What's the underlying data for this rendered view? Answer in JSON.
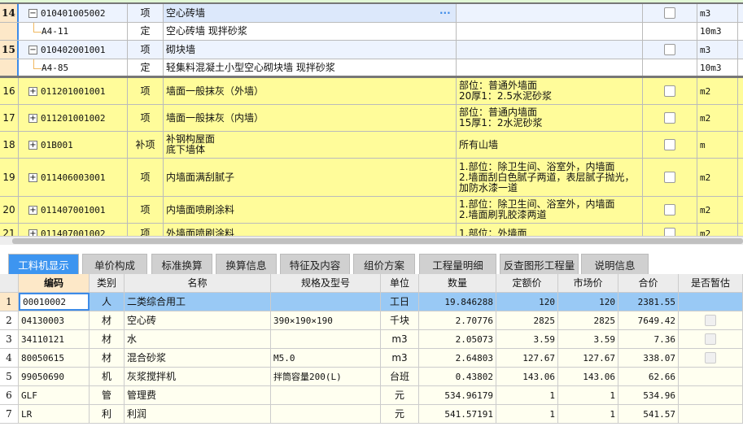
{
  "top_grid": {
    "rows": [
      {
        "num": "14",
        "code": "010401005002",
        "type": "项",
        "name": "空心砖墙",
        "feature": "",
        "unit": "m3",
        "kind": "item-open",
        "has_ellipsis": true
      },
      {
        "num": "",
        "code": "A4-11",
        "type": "定",
        "name": "空心砖墙 现拌砂浆",
        "feature": "",
        "unit": "10m3",
        "kind": "sub"
      },
      {
        "num": "15",
        "code": "010402001001",
        "type": "项",
        "name": "砌块墙",
        "feature": "",
        "unit": "m3",
        "kind": "item-open"
      },
      {
        "num": "",
        "code": "A4-85",
        "type": "定",
        "name": "轻集料混凝土小型空心砌块墙 现拌砂浆",
        "feature": "",
        "unit": "10m3",
        "kind": "sub"
      },
      {
        "num": "16",
        "code": "011201001001",
        "type": "项",
        "name": "墙面一般抹灰（外墙）",
        "feature": "部位：普通外墙面\n20厚1：2.5水泥砂浆",
        "unit": "m2",
        "kind": "item"
      },
      {
        "num": "17",
        "code": "011201001002",
        "type": "项",
        "name": "墙面一般抹灰（内墙）",
        "feature": "部位：普通内墙面\n15厚1：2水泥砂浆",
        "unit": "m2",
        "kind": "item"
      },
      {
        "num": "18",
        "code": "01B001",
        "type": "补项",
        "name": "补钢构屋面\n底下墙体",
        "feature": "所有山墙",
        "unit": "m",
        "kind": "item"
      },
      {
        "num": "19",
        "code": "011406003001",
        "type": "项",
        "name": "内墙面满刮腻子",
        "feature": "1.部位：除卫生间、浴室外，内墙面\n2.墙面刮白色腻子两道，表层腻子抛光，\n加防水漆一道",
        "unit": "m2",
        "kind": "item"
      },
      {
        "num": "20",
        "code": "011407001001",
        "type": "项",
        "name": "内墙面喷刷涂料",
        "feature": "1.部位：除卫生间、浴室外，内墙面\n2.墙面刷乳胶漆两道",
        "unit": "m2",
        "kind": "item"
      },
      {
        "num": "21",
        "code": "011407001002",
        "type": "项",
        "name": "外墙面喷刷涂料",
        "feature": "1.部位：外墙面",
        "unit": "m2",
        "kind": "item"
      }
    ]
  },
  "tabs": [
    "工料机显示",
    "单价构成",
    "标准换算",
    "换算信息",
    "特征及内容",
    "组价方案",
    "工程量明细",
    "反查图形工程量",
    "说明信息"
  ],
  "bottom_grid": {
    "headers": [
      "编码",
      "类别",
      "名称",
      "规格及型号",
      "单位",
      "数量",
      "定额价",
      "市场价",
      "合价",
      "是否暂估"
    ],
    "rows": [
      [
        "1",
        "00010002",
        "人",
        "二类综合用工",
        "",
        "工日",
        "19.846288",
        "120",
        "120",
        "2381.55"
      ],
      [
        "2",
        "04130003",
        "材",
        "空心砖",
        "390×190×190",
        "千块",
        "2.70776",
        "2825",
        "2825",
        "7649.42"
      ],
      [
        "3",
        "34110121",
        "材",
        "水",
        "",
        "m3",
        "2.05073",
        "3.59",
        "3.59",
        "7.36"
      ],
      [
        "4",
        "80050615",
        "材",
        "混合砂浆",
        "M5.0",
        "m3",
        "2.64803",
        "127.67",
        "127.67",
        "338.07"
      ],
      [
        "5",
        "99050690",
        "机",
        "灰浆搅拌机",
        "拌筒容量200(L)",
        "台班",
        "0.43802",
        "143.06",
        "143.06",
        "62.66"
      ],
      [
        "6",
        "GLF",
        "管",
        "管理费",
        "",
        "元",
        "534.96179",
        "1",
        "1",
        "534.96"
      ],
      [
        "7",
        "LR",
        "利",
        "利润",
        "",
        "元",
        "541.57191",
        "1",
        "1",
        "541.57"
      ]
    ]
  }
}
